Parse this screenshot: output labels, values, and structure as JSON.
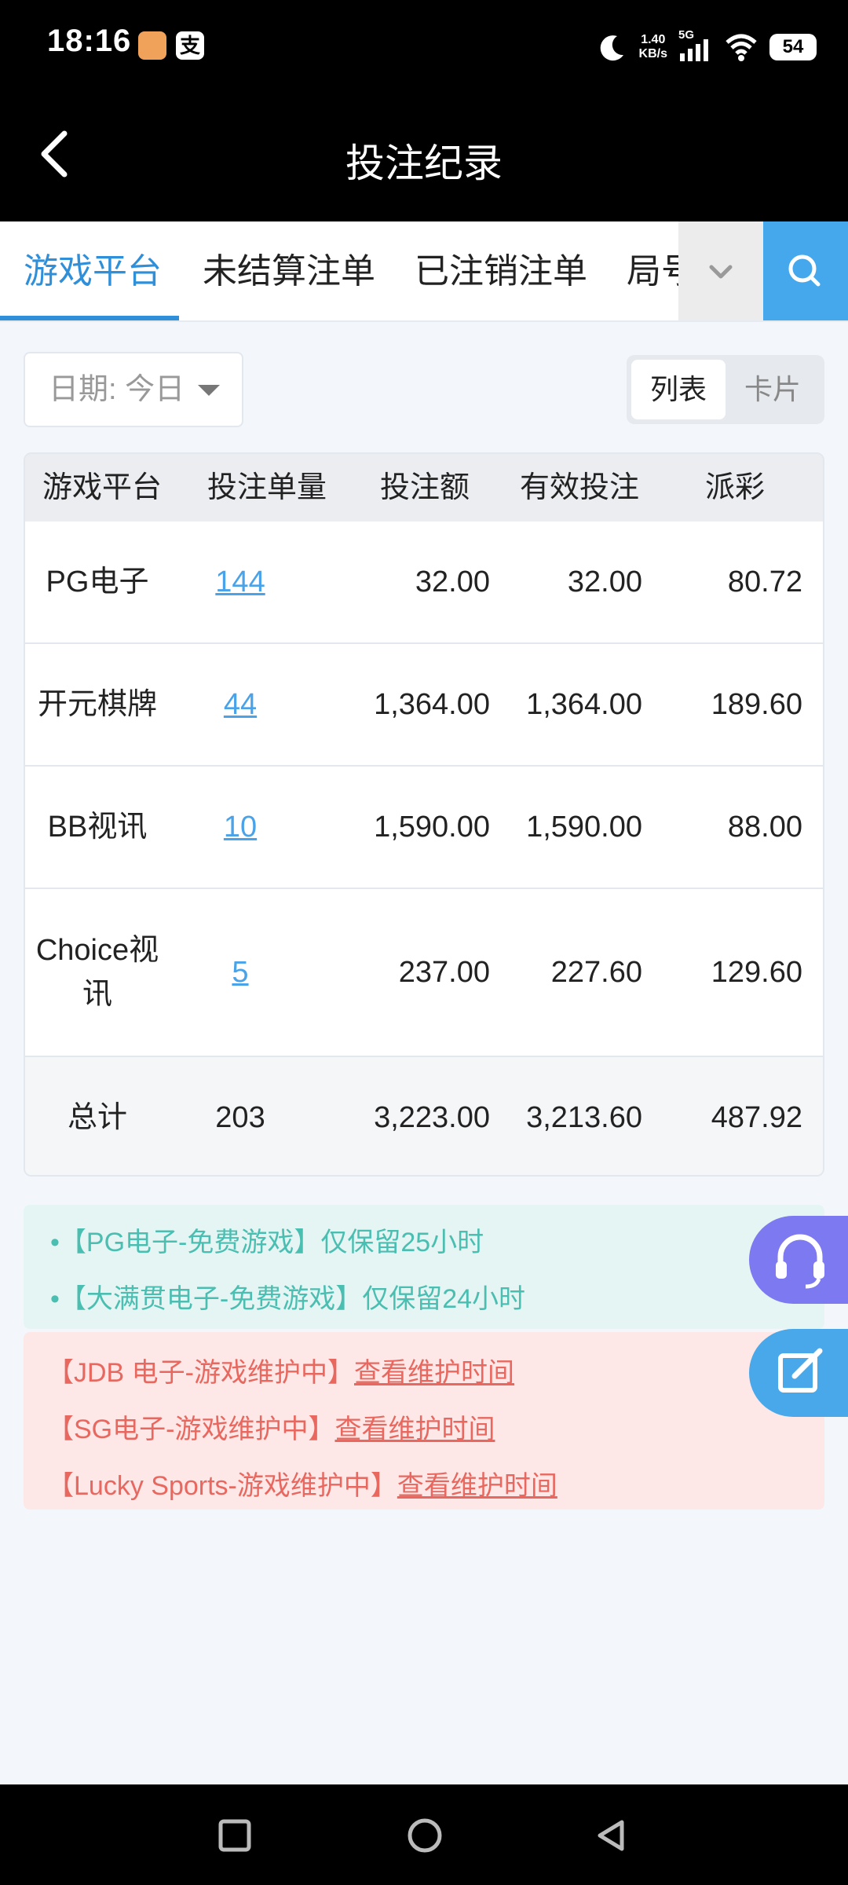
{
  "status_bar": {
    "time": "18:16",
    "net_speed_value": "1.40",
    "net_speed_unit": "KB/s",
    "network": "5G",
    "battery": "54"
  },
  "header": {
    "title": "投注纪录"
  },
  "tabs": [
    {
      "label": "游戏平台"
    },
    {
      "label": "未结算注单"
    },
    {
      "label": "已注销注单"
    },
    {
      "label": "局号"
    }
  ],
  "filter": {
    "date_label": "日期: 今日",
    "view_list": "列表",
    "view_card": "卡片"
  },
  "table": {
    "headers": [
      "游戏平台",
      "投注单量",
      "投注额",
      "有效投注",
      "派彩"
    ],
    "rows": [
      {
        "platform": "PG电子",
        "count": "144",
        "bet": "32.00",
        "valid": "32.00",
        "payout": "80.72"
      },
      {
        "platform": "开元棋牌",
        "count": "44",
        "bet": "1,364.00",
        "valid": "1,364.00",
        "payout": "189.60"
      },
      {
        "platform": "BB视讯",
        "count": "10",
        "bet": "1,590.00",
        "valid": "1,590.00",
        "payout": "88.00"
      },
      {
        "platform": "Choice视讯",
        "count": "5",
        "bet": "237.00",
        "valid": "227.60",
        "payout": "129.60"
      }
    ],
    "total": {
      "label": "总计",
      "count": "203",
      "bet": "3,223.00",
      "valid": "3,213.60",
      "payout": "487.92"
    }
  },
  "notices_info": [
    "•【PG电子-免费游戏】仅保留25小时",
    "•【大满贯电子-免费游戏】仅保留24小时"
  ],
  "notices_maintenance": [
    {
      "text": "【JDB 电子-游戏维护中】",
      "link": "查看维护时间"
    },
    {
      "text": "【SG电子-游戏维护中】",
      "link": "查看维护时间"
    },
    {
      "text": "【Lucky Sports-游戏维护中】",
      "link": "查看维护时间"
    }
  ],
  "colors": {
    "accent": "#2f8fd9",
    "link": "#4aa3e8",
    "info_text": "#4bbeb2",
    "warn_text": "#e8685f",
    "service_button": "#7d79f0",
    "edit_button": "#49a8ea"
  },
  "icons": {
    "back": "chevron-left-icon",
    "more": "chevron-down-icon",
    "search": "search-icon",
    "service": "headset-icon",
    "edit": "edit-icon"
  }
}
